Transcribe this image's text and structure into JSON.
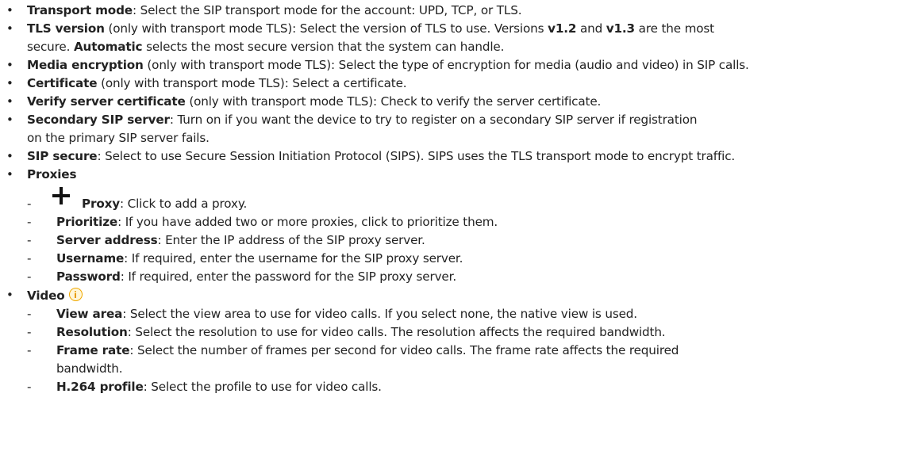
{
  "items": [
    {
      "label": "Transport mode",
      "text": ": Select the SIP transport mode for the account: UPD, TCP, or TLS."
    },
    {
      "label": "TLS version",
      "text_a": " (only with transport mode TLS): Select the version of TLS to use. Versions ",
      "v12": "v1.2",
      "and": " and ",
      "v13": "v1.3",
      "text_b": " are the most",
      "line2_pre": "secure. ",
      "automatic": "Automatic",
      "line2_post": " selects the most secure version that the system can handle."
    },
    {
      "label": "Media encryption",
      "text": " (only with transport mode TLS): Select the type of encryption for media (audio and video) in SIP calls."
    },
    {
      "label": "Certificate",
      "text": " (only with transport mode TLS): Select a certificate."
    },
    {
      "label": "Verify server certificate",
      "text": " (only with transport mode TLS): Check to verify the server certificate."
    },
    {
      "label": "Secondary SIP server",
      "text": ": Turn on if you want the device to try to register on a secondary SIP server if registration",
      "text2": "on the primary SIP server fails."
    },
    {
      "label": "SIP secure",
      "text": ": Select to use Secure Session Initiation Protocol (SIPS). SIPS uses the TLS transport mode to encrypt traffic."
    },
    {
      "label": "Proxies"
    },
    {
      "label": "Video"
    }
  ],
  "proxies": [
    {
      "label": "Proxy",
      "text": ": Click to add a proxy."
    },
    {
      "label": "Prioritize",
      "text": ": If you have added two or more proxies, click to prioritize them."
    },
    {
      "label": "Server address",
      "text": ": Enter the IP address of the SIP proxy server."
    },
    {
      "label": "Username",
      "text": ": If required, enter the username for the SIP proxy server."
    },
    {
      "label": "Password",
      "text": ": If required, enter the password for the SIP proxy server."
    }
  ],
  "video": [
    {
      "label": "View area",
      "text": ": Select the view area to use for video calls. If you select none, the native view is used."
    },
    {
      "label": "Resolution",
      "text": ": Select the resolution to use for video calls. The resolution affects the required bandwidth."
    },
    {
      "label": "Frame rate",
      "text": ": Select the number of frames per second for video calls. The frame rate affects the required",
      "text2": "bandwidth."
    },
    {
      "label": "H.264 profile",
      "text": ": Select the profile to use for video calls."
    }
  ],
  "symbols": {
    "bullet": "•",
    "dash": "-"
  },
  "icons": {
    "add": "plus-icon",
    "info": "info-icon"
  },
  "colors": {
    "text": "#222222",
    "info_icon": "#f0a800"
  }
}
